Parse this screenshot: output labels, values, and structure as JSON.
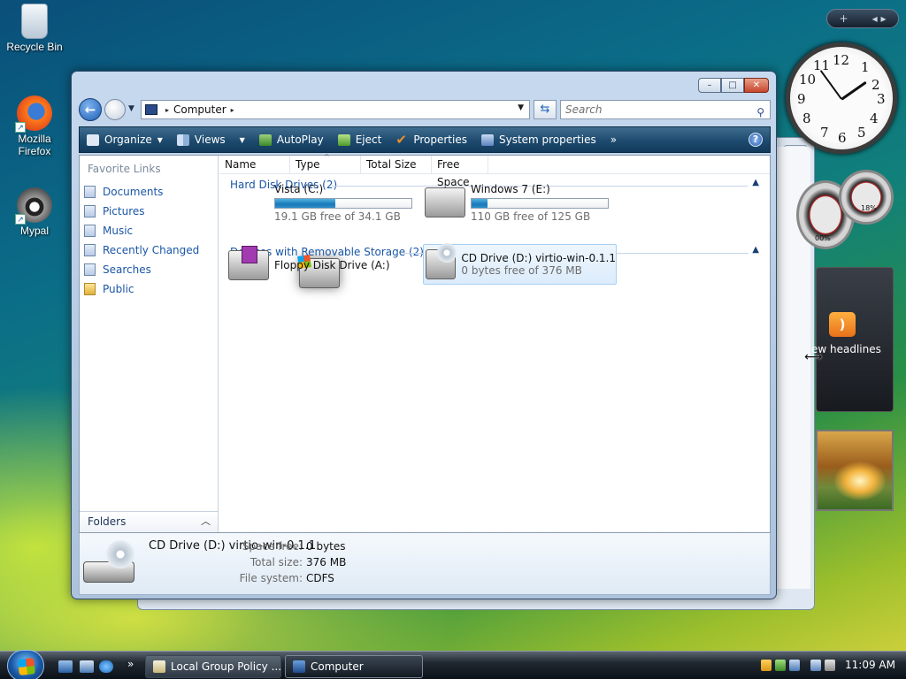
{
  "desktop": {
    "icons": [
      {
        "label": "Recycle Bin",
        "icon": "recycle-bin-icon"
      },
      {
        "label": "Mozilla Firefox",
        "icon": "firefox-icon"
      },
      {
        "label": "Mypal",
        "icon": "mypal-icon"
      }
    ],
    "background_colors": [
      "#0a4f7a",
      "#11807a",
      "#9cbf2c",
      "#d9d440"
    ]
  },
  "window": {
    "title_buttons": {
      "minimize": "–",
      "maximize": "□",
      "close": "✕"
    },
    "address": {
      "root_symbol": "▸",
      "crumb": "Computer",
      "separator": "▸"
    },
    "search": {
      "placeholder": "Search"
    },
    "toolbar": {
      "organize": "Organize",
      "views": "Views",
      "autoplay": "AutoPlay",
      "eject": "Eject",
      "properties": "Properties",
      "system_properties": "System properties",
      "more": "»",
      "help": "?"
    },
    "nav_pane": {
      "title": "Favorite Links",
      "items": [
        "Documents",
        "Pictures",
        "Music",
        "Recently Changed",
        "Searches",
        "Public"
      ],
      "folders_label": "Folders"
    },
    "columns": [
      "Name",
      "Type",
      "Total Size",
      "Free Space"
    ],
    "groups": [
      {
        "label": "Hard Disk Drives (2)",
        "drives": [
          {
            "name": "Vista (C:)",
            "detail": "19.1 GB free of 34.1 GB",
            "used_fraction": 0.44
          },
          {
            "name": "Windows 7 (E:)",
            "detail": "110 GB free of 125 GB",
            "used_fraction": 0.12
          }
        ]
      },
      {
        "label": "Devices with Removable Storage (2)",
        "drives": [
          {
            "name": "Floppy Disk Drive (A:)"
          },
          {
            "name": "CD Drive (D:) virtio-win-0.1.1",
            "detail": "0 bytes free of 376 MB",
            "selected": true
          }
        ]
      }
    ],
    "details": {
      "name": "CD Drive (D:) virtio-win-0.1.1",
      "space_free_label": "Space free:",
      "space_free": "0 bytes",
      "total_size_label": "Total size:",
      "total_size": "376 MB",
      "file_system_label": "File system:",
      "file_system": "CDFS"
    }
  },
  "taskbar": {
    "tasks": [
      "Local Group Policy ...",
      "Computer"
    ],
    "clock": "11:09 AM",
    "quick_launch_more": "»"
  },
  "sidebar": {
    "add_symbol": "+",
    "nav_symbols": "◂ ▸",
    "clock_numbers": [
      "12",
      "1",
      "2",
      "3",
      "4",
      "5",
      "6",
      "7",
      "8",
      "9",
      "10",
      "11"
    ],
    "meter_readout": "18%",
    "meter_readout_2": "00%",
    "feed_label": "ew headlines",
    "feed_icon": "rss-icon"
  }
}
